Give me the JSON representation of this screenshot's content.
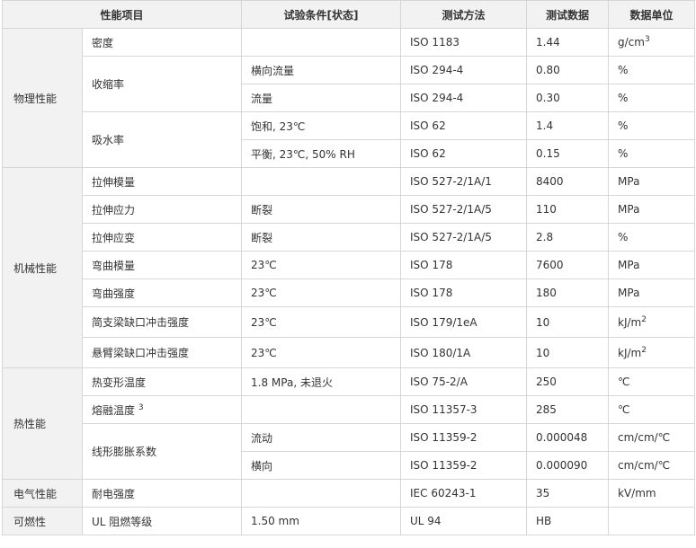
{
  "headers": [
    "性能项目",
    "试验条件[状态]",
    "测试方法",
    "测试数据",
    "数据单位"
  ],
  "categories": {
    "physical": "物理性能",
    "mechanical": "机械性能",
    "thermal": "热性能",
    "electrical": "电气性能",
    "flammability": "可燃性"
  },
  "rows": [
    {
      "property": "密度",
      "condition": "",
      "method": "ISO 1183",
      "value": "1.44",
      "unit": "g/cm",
      "unit_sup": "3"
    },
    {
      "property": "收缩率",
      "condition": "横向流量",
      "method": "ISO 294-4",
      "value": "0.80",
      "unit": "%"
    },
    {
      "property": "",
      "condition": "流量",
      "method": "ISO 294-4",
      "value": "0.30",
      "unit": "%"
    },
    {
      "property": "吸水率",
      "condition": "饱和, 23℃",
      "method": "ISO 62",
      "value": "1.4",
      "unit": "%"
    },
    {
      "property": "",
      "condition": "平衡, 23℃, 50% RH",
      "method": "ISO 62",
      "value": "0.15",
      "unit": "%"
    },
    {
      "property": "拉伸模量",
      "condition": "",
      "method": "ISO 527-2/1A/1",
      "value": "8400",
      "unit": "MPa"
    },
    {
      "property": "拉伸应力",
      "condition": "断裂",
      "method": "ISO 527-2/1A/5",
      "value": "110",
      "unit": "MPa"
    },
    {
      "property": "拉伸应变",
      "condition": "断裂",
      "method": "ISO 527-2/1A/5",
      "value": "2.8",
      "unit": "%"
    },
    {
      "property": "弯曲模量",
      "condition": "23℃",
      "method": "ISO 178",
      "value": "7600",
      "unit": "MPa"
    },
    {
      "property": "弯曲强度",
      "condition": "23℃",
      "method": "ISO 178",
      "value": "180",
      "unit": "MPa"
    },
    {
      "property": "简支梁缺口冲击强度",
      "condition": "23℃",
      "method": "ISO 179/1eA",
      "value": "10",
      "unit": "kJ/m",
      "unit_sup": "2"
    },
    {
      "property": "悬臂梁缺口冲击强度",
      "condition": "23℃",
      "method": "ISO 180/1A",
      "value": "10",
      "unit": "kJ/m",
      "unit_sup": "2"
    },
    {
      "property": "热变形温度",
      "condition": "1.8 MPa, 未退火",
      "method": "ISO 75-2/A",
      "value": "250",
      "unit": "℃"
    },
    {
      "property": "熔融温度",
      "property_sup": "3",
      "condition": "",
      "method": "ISO 11357-3",
      "value": "285",
      "unit": "℃"
    },
    {
      "property": "线形膨胀系数",
      "condition": "流动",
      "method": "ISO 11359-2",
      "value": "0.000048",
      "unit": "cm/cm/℃"
    },
    {
      "property": "",
      "condition": "横向",
      "method": "ISO 11359-2",
      "value": "0.000090",
      "unit": "cm/cm/℃"
    },
    {
      "property": "耐电强度",
      "condition": "",
      "method": "IEC 60243-1",
      "value": "35",
      "unit": "kV/mm"
    },
    {
      "property": "UL 阻燃等级",
      "condition": "1.50 mm",
      "method": "UL 94",
      "value": "HB",
      "unit": ""
    }
  ]
}
